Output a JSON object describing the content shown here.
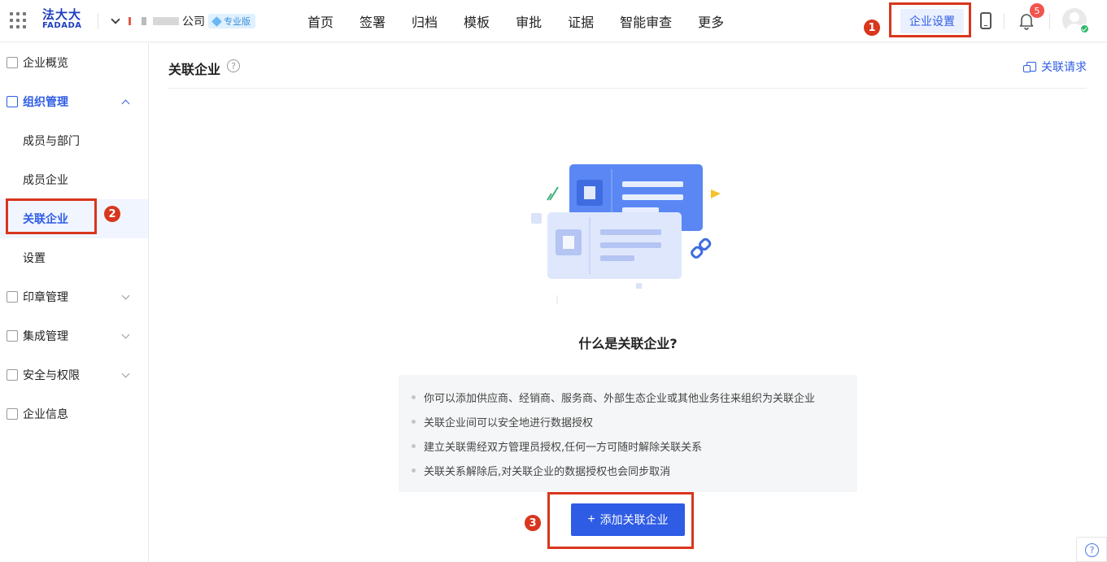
{
  "header": {
    "logo_cn": "法大大",
    "logo_en": "FADADA",
    "company_suffix": "公司",
    "plan_badge": "专业版",
    "nav": [
      "首页",
      "签署",
      "归档",
      "模板",
      "审批",
      "证据",
      "智能审查",
      "更多"
    ],
    "settings_button": "企业设置",
    "notification_count": "5"
  },
  "annotations": [
    "1",
    "2",
    "3"
  ],
  "sidebar": {
    "items": [
      {
        "label": "企业概览"
      },
      {
        "label": "组织管理",
        "sub": [
          "成员与部门",
          "成员企业",
          "关联企业",
          "设置"
        ]
      },
      {
        "label": "印章管理"
      },
      {
        "label": "集成管理"
      },
      {
        "label": "安全与权限"
      },
      {
        "label": "企业信息"
      }
    ]
  },
  "main": {
    "title": "关联企业",
    "help": "?",
    "request_link": "关联请求",
    "headline": "什么是关联企业?",
    "bullets": [
      "你可以添加供应商、经销商、服务商、外部生态企业或其他业务往来组织为关联企业",
      "关联企业间可以安全地进行数据授权",
      "建立关联需经双方管理员授权,任何一方可随时解除关联关系",
      "关联关系解除后,对关联企业的数据授权也会同步取消"
    ],
    "add_button_icon": "+",
    "add_button": "添加关联企业"
  },
  "colors": {
    "accent": "#2f5ce5",
    "annotation": "#d8361d"
  },
  "float_help": "?"
}
